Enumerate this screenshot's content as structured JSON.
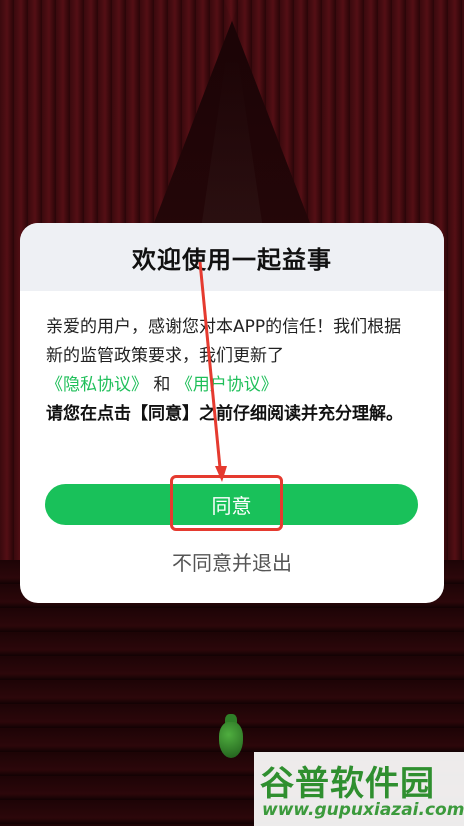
{
  "dialog": {
    "title": "欢迎使用一起益事",
    "body_line1": "亲爱的用户，感谢您对本APP的信任！我们根据新的监管政策要求，我们更新了",
    "privacy_link": "《隐私协议》",
    "and_text": "和",
    "user_link": "《用户协议》",
    "bold_notice": "请您在点击【同意】之前仔细阅读并充分理解。",
    "agree_label": "同意",
    "disagree_label": "不同意并退出"
  },
  "watermark": {
    "title": "谷普软件园",
    "url": "www.gupuxiazai.com"
  },
  "colors": {
    "accent": "#19c15a",
    "link": "#1fbf5a",
    "annotation": "#e53a2f"
  }
}
